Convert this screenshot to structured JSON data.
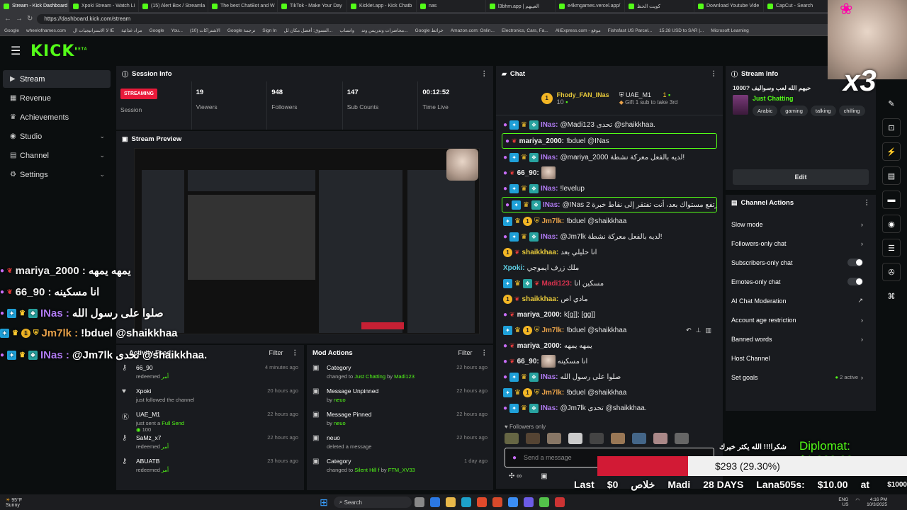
{
  "browser": {
    "tabs": [
      "Stream - Kick Dashboard",
      "Xpoki Stream - Watch Li",
      "(15) Alert Box / Streamla",
      "The best ChatBot and W",
      "TikTok - Make Your Day",
      "Kicklet.app - Kick Chatb",
      "nas",
      "l3bhm.app | العيبهم",
      "e4kmgames.vercel.app/",
      "كويت الحظ",
      "Download Youtube Vide",
      "CapCut - Search"
    ],
    "url": "https://dashboard.kick.com/stream",
    "bookmarks": [
      "Google",
      "wheelofnames.com",
      "لا الاستراتيجيات ال IE",
      "مراد غذائية",
      "Google",
      "You...",
      "الاشتراكات (10)",
      "Google ترجمة",
      "Sign In",
      "التسوق: أفضل مكان لل...",
      "واتساب",
      "محاضرات وتدريس وتد...",
      "Google خرائط",
      "Amazon.com: Onlin...",
      "Electronics, Cars, Fa...",
      "AliExpress.com - موقع",
      "Fishsfast US Parcel...",
      "15.28 USD to SAR |...",
      "Microsoft Learning"
    ]
  },
  "app": {
    "logo": "KICK",
    "logo_tag": "BETA"
  },
  "nav": {
    "items": [
      {
        "label": "Stream",
        "icon": "stream-icon"
      },
      {
        "label": "Revenue",
        "icon": "revenue-icon"
      },
      {
        "label": "Achievements",
        "icon": "trophy-icon"
      },
      {
        "label": "Studio",
        "icon": "studio-icon"
      },
      {
        "label": "Channel",
        "icon": "channel-icon"
      },
      {
        "label": "Settings",
        "icon": "gear-icon"
      }
    ]
  },
  "session": {
    "title": "Session Info",
    "status": "STREAMING",
    "status_label": "Session",
    "viewers": "19",
    "viewers_label": "Viewers",
    "followers": "948",
    "followers_label": "Followers",
    "subs": "147",
    "subs_label": "Sub Counts",
    "time": "00:12:52",
    "time_label": "Time Live"
  },
  "preview": {
    "title": "Stream Preview"
  },
  "activity": {
    "title": "Activity Feed",
    "filter": "Filter",
    "items": [
      {
        "name": "66_90",
        "action": "redeemed",
        "extra": "أمر",
        "time": "4 minutes ago"
      },
      {
        "name": "Xpoki",
        "action": "just followed the channel",
        "extra": "",
        "time": "20 hours ago"
      },
      {
        "name": "UAE_M1",
        "action": "just sent a",
        "extra": "Full Send",
        "count": "100",
        "time": "22 hours ago"
      },
      {
        "name": "SaMz_x7",
        "action": "redeemed",
        "extra": "أمر",
        "time": "22 hours ago"
      },
      {
        "name": "ABUATB",
        "action": "redeemed",
        "extra": "أمر",
        "time": "23 hours ago"
      }
    ]
  },
  "mod": {
    "title": "Mod Actions",
    "filter": "Filter",
    "items": [
      {
        "title": "Category",
        "desc": "changed to",
        "target": "Just Chatting",
        "by_word": "by",
        "by": "Madi123",
        "time": "22 hours ago"
      },
      {
        "title": "Message Unpinned",
        "desc": "by",
        "target": "",
        "by_word": "",
        "by": "neuo",
        "time": "22 hours ago"
      },
      {
        "title": "Message Pinned",
        "desc": "by",
        "target": "",
        "by_word": "",
        "by": "neuo",
        "time": "22 hours ago"
      },
      {
        "title": "neuo",
        "desc": "deleted a message",
        "target": "",
        "by_word": "",
        "by": "",
        "time": "22 hours ago"
      },
      {
        "title": "Category",
        "desc": "changed to",
        "target": "Silent Hill f",
        "by_word": "by",
        "by": "FTM_XV33",
        "time": "1 day ago"
      }
    ]
  },
  "chat": {
    "title": "Chat",
    "leader1": {
      "name": "Fhody_FAN_INas",
      "amount": "10"
    },
    "leader2": {
      "name": "UAE_M1",
      "amount": "1"
    },
    "gift_note": "Gift 1 sub to take 3rd",
    "messages": [
      {
        "user": "INas:",
        "text": "@Madi123 تحدى @shaikkhaa.",
        "ucls": "u-purple"
      },
      {
        "user": "mariya_2000:",
        "text": "!bduel @INas",
        "ucls": "u-white"
      },
      {
        "user": "INas:",
        "text": "@mariya_2000 لديه بالفعل معركة نشطة!",
        "ucls": "u-purple"
      },
      {
        "user": "66_90:",
        "text": "",
        "ucls": "u-white"
      },
      {
        "user": "INas:",
        "text": "!levelup",
        "ucls": "u-purple"
      },
      {
        "user": "INas:",
        "text": "@INas لم ترتفع مستواك بعد، أنت تفتقر إلى نقاط خبرة 2.",
        "ucls": "u-purple"
      },
      {
        "user": "Jm7lk:",
        "text": "!bduel @shaikkhaa",
        "ucls": "u-orange"
      },
      {
        "user": "INas:",
        "text": "@Jm7lk لديه بالفعل معركة نشطة!",
        "ucls": "u-purple"
      },
      {
        "user": "shaikkhaa:",
        "text": "انا حليلي بعد",
        "ucls": "u-gold"
      },
      {
        "user": "Xpoki:",
        "text": "ملك زرف ايموجي",
        "ucls": "u-cyan"
      },
      {
        "user": "Madi123:",
        "text": "مسكين انا",
        "ucls": "u-red"
      },
      {
        "user": "shaikkhaa:",
        "text": "مادي اص",
        "ucls": "u-gold"
      },
      {
        "user": "mariya_2000:",
        "text": "k[g]]; [gg]]",
        "ucls": "u-white"
      },
      {
        "user": "Jm7lk:",
        "text": "!bduel @shaikkhaa",
        "ucls": "u-orange"
      },
      {
        "user": "mariya_2000:",
        "text": "يمهه يمهه",
        "ucls": "u-white"
      },
      {
        "user": "66_90:",
        "text": "انا مسكينه",
        "ucls": "u-white"
      },
      {
        "user": "INas:",
        "text": "صلوا على رسول الله",
        "ucls": "u-purple"
      },
      {
        "user": "Jm7lk:",
        "text": "!bduel @shaikkhaa",
        "ucls": "u-orange"
      },
      {
        "user": "INas:",
        "text": "@Jm7lk تحدى @shaikkhaa.",
        "ucls": "u-purple"
      }
    ],
    "followers_only": "Followers only",
    "placeholder": "Send a message"
  },
  "stream_info": {
    "title": "Stream Info",
    "stream_title": "حيهم الله لعب وسواليف ?1000",
    "category": "Just Chatting",
    "tags": [
      "Arabic",
      "gaming",
      "talking",
      "chilling"
    ],
    "edit": "Edit"
  },
  "channel_actions": {
    "title": "Channel Actions",
    "items": [
      {
        "label": "Slow mode",
        "kind": "chev"
      },
      {
        "label": "Followers-only chat",
        "kind": "chev"
      },
      {
        "label": "Subscribers-only chat",
        "kind": "toggle"
      },
      {
        "label": "Emotes-only chat",
        "kind": "toggle"
      },
      {
        "label": "AI Chat Moderation",
        "kind": "link"
      },
      {
        "label": "Account age restriction",
        "kind": "chev"
      },
      {
        "label": "Banned words",
        "kind": "chev"
      },
      {
        "label": "Host Channel",
        "kind": "none"
      },
      {
        "label": "Set goals",
        "kind": "chev",
        "badge": "2 active"
      }
    ]
  },
  "overlay": {
    "multiplier": "x3",
    "chat": [
      {
        "user": "mariya_2000 :",
        "text": "يمهه يمهه"
      },
      {
        "user": "66_90 :",
        "text": "انا مسكينه"
      },
      {
        "user": "INas :",
        "text": "صلوا على رسول الله"
      },
      {
        "user": "Jm7lk :",
        "text": "!bduel @shaikkhaa"
      },
      {
        "user": "INas :",
        "text": "@Jm7lk تحدى @shaikkhaa."
      }
    ],
    "diplomat": "Diplomat: $1,000.00",
    "goal_text": "$293 (29.30%)",
    "goal_progress": 0.293,
    "thanks": "شكرا!!! الله يكثر خيرك",
    "ticker": [
      "Last",
      "$0",
      "خلاص",
      "Madi",
      "28 DAYS",
      "Lana505s:",
      "$10.00",
      "at"
    ],
    "ticker_right": "$1000"
  },
  "taskbar": {
    "search": "Search",
    "weather_temp": "95°F",
    "weather_label": "Sunny",
    "lang": "ENG US",
    "time": "4:16 PM",
    "date": "10/3/2025"
  }
}
